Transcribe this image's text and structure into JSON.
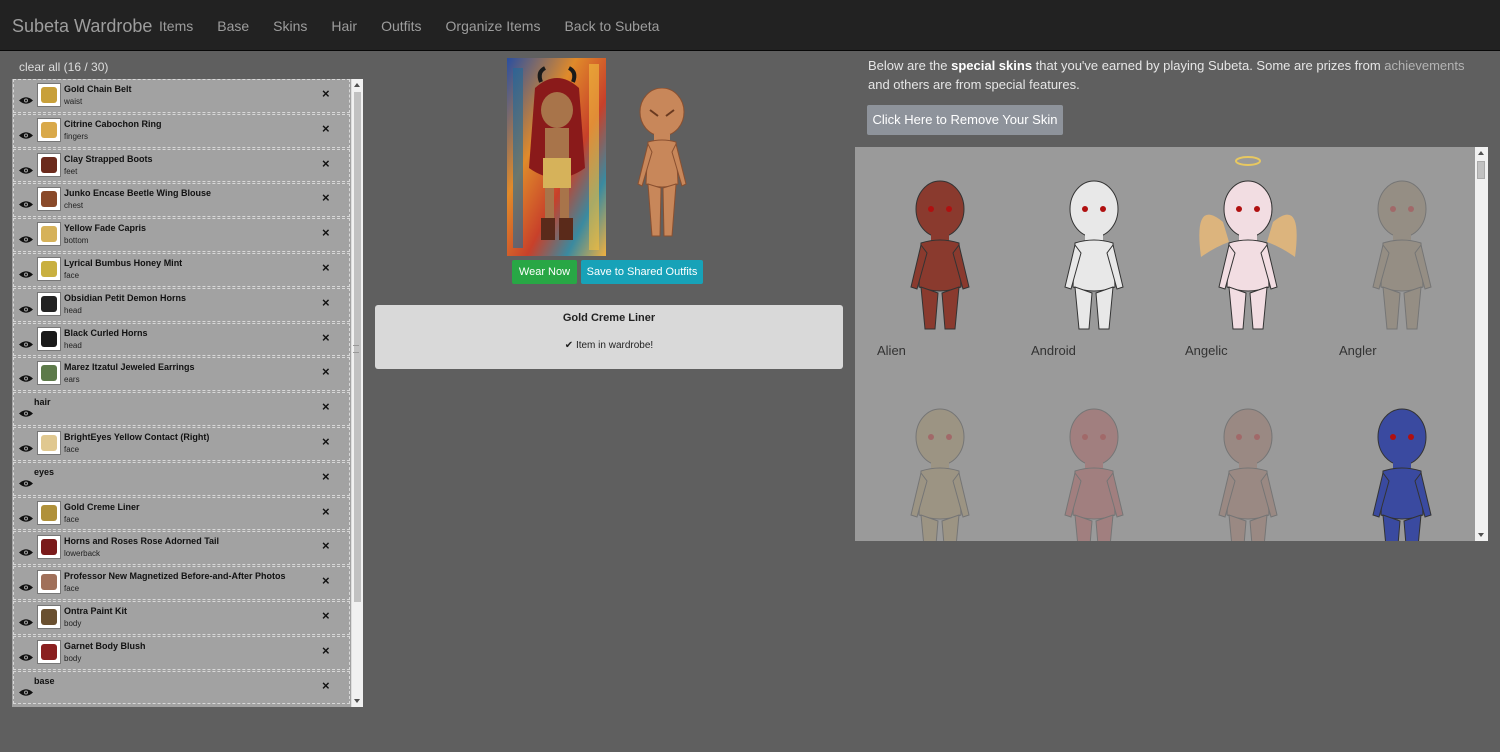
{
  "navbar": {
    "brand": "Subeta Wardrobe",
    "items": [
      "Items",
      "Base",
      "Skins",
      "Hair",
      "Outfits",
      "Organize Items",
      "Back to Subeta"
    ]
  },
  "wardrobe": {
    "clear_all": "clear all (16 / 30)",
    "remove_symbol": "×",
    "rows": [
      {
        "type": "item",
        "name": "Gold Chain Belt",
        "slot": "waist",
        "color": "#c8a03a"
      },
      {
        "type": "item",
        "name": "Citrine Cabochon Ring",
        "slot": "fingers",
        "color": "#d9a94a"
      },
      {
        "type": "item",
        "name": "Clay Strapped Boots",
        "slot": "feet",
        "color": "#6b2a1c"
      },
      {
        "type": "item",
        "name": "Junko Encase Beetle Wing Blouse",
        "slot": "chest",
        "color": "#8a4a2a"
      },
      {
        "type": "item",
        "name": "Yellow Fade Capris",
        "slot": "bottom",
        "color": "#d6b25a"
      },
      {
        "type": "item",
        "name": "Lyrical Bumbus Honey Mint",
        "slot": "face",
        "color": "#c9b040"
      },
      {
        "type": "item",
        "name": "Obsidian Petit Demon Horns",
        "slot": "head",
        "color": "#222222"
      },
      {
        "type": "item",
        "name": "Black Curled Horns",
        "slot": "head",
        "color": "#1a1a1a"
      },
      {
        "type": "item",
        "name": "Marez Itzatul Jeweled Earrings",
        "slot": "ears",
        "color": "#5d7a4a"
      },
      {
        "type": "slot",
        "name": "hair"
      },
      {
        "type": "item",
        "name": "BrightEyes Yellow Contact (Right)",
        "slot": "face",
        "color": "#e0c890"
      },
      {
        "type": "slot",
        "name": "eyes"
      },
      {
        "type": "item",
        "name": "Gold Creme Liner",
        "slot": "face",
        "color": "#b0913a"
      },
      {
        "type": "item",
        "name": "Horns and Roses Rose Adorned Tail",
        "slot": "lowerback",
        "color": "#7a1a1a"
      },
      {
        "type": "item",
        "name": "Professor New Magnetized Before-and-After Photos",
        "slot": "face",
        "color": "#a0705a"
      },
      {
        "type": "item",
        "name": "Ontra Paint Kit",
        "slot": "body",
        "color": "#6a5030"
      },
      {
        "type": "item",
        "name": "Garnet Body Blush",
        "slot": "body",
        "color": "#8a1f1f"
      },
      {
        "type": "slot",
        "name": "base"
      }
    ]
  },
  "preview": {
    "wear_now": "Wear Now",
    "save_shared": "Save to Shared Outfits"
  },
  "item_info": {
    "title": "Gold Creme Liner",
    "status": "✔ Item in wardrobe!"
  },
  "skins": {
    "intro_prefix": "Below are the ",
    "intro_bold": "special skins",
    "intro_middle": " that you've earned by playing Subeta. Some are prizes from ",
    "intro_link": "achievements",
    "intro_suffix": " and others are from special features.",
    "remove_button": "Click Here to Remove Your Skin",
    "items": [
      {
        "name": "Alien",
        "color": "#8a3a2e",
        "faded": false
      },
      {
        "name": "Android",
        "color": "#e8e8e8",
        "faded": false
      },
      {
        "name": "Angelic",
        "color": "#f2dde2",
        "faded": false
      },
      {
        "name": "Angler",
        "color": "#8c7a5c",
        "faded": true
      },
      {
        "name": "",
        "color": "#a08a5a",
        "faded": true
      },
      {
        "name": "",
        "color": "#b05050",
        "faded": true
      },
      {
        "name": "",
        "color": "#9a6a5a",
        "faded": true
      },
      {
        "name": "",
        "color": "#3a4aa0",
        "faded": false
      }
    ]
  }
}
